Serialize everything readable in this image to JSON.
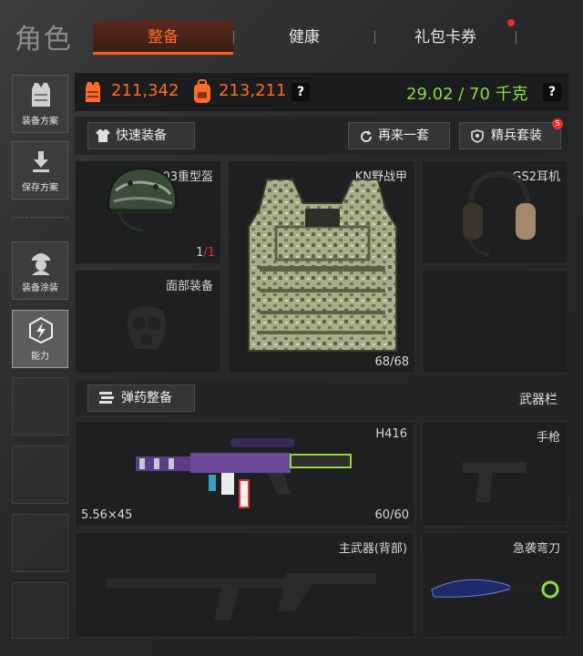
{
  "title": "角色",
  "tabs": [
    {
      "label": "整备"
    },
    {
      "label": "健康"
    },
    {
      "label": "礼包卡券"
    }
  ],
  "stats": {
    "value1": "211,342",
    "value2": "213,211",
    "help": "?",
    "weight": "29.02 / 70 千克"
  },
  "sidebar": {
    "items": [
      {
        "label": "装备方案"
      },
      {
        "label": "保存方案"
      },
      {
        "label": "装备涂装"
      },
      {
        "label": "能力"
      }
    ]
  },
  "actions": {
    "quick_equip": "快速装备",
    "again": "再来一套",
    "elite": "精兵套装",
    "elite_badge": "5"
  },
  "slots": {
    "helmet": {
      "label": "303重型盔",
      "count_a": "1",
      "count_b": "/1"
    },
    "armor": {
      "label": "KN野战甲",
      "count": "68/68"
    },
    "headset": {
      "label": "GS2耳机"
    },
    "face": {
      "label": "面部装备"
    }
  },
  "weapons_bar": {
    "ammo_button": "弹药整备",
    "label": "武器栏"
  },
  "weapons": {
    "primary": {
      "label": "H416",
      "caliber": "5.56×45",
      "ammo": "60/60"
    },
    "pistol": {
      "label": "手枪"
    },
    "back": {
      "label": "主武器(背部)"
    },
    "melee": {
      "label": "急袭弯刀"
    }
  },
  "colors": {
    "accent": "#ff6a2a",
    "weight": "#8fdc3c"
  }
}
